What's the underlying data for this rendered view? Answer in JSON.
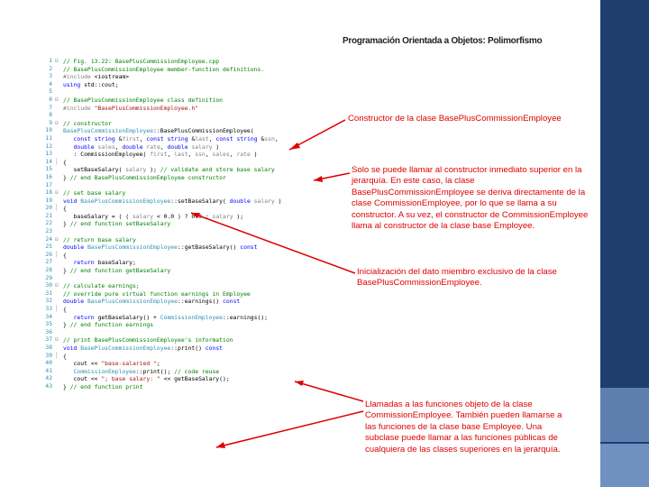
{
  "slide_title": "Programación Orientada a Objetos: Polimorfismo",
  "colors": {
    "annotation": "#e00000",
    "sidebar": "#1f3d6e",
    "comment": "#008000",
    "keyword": "#0000ff"
  },
  "editor": {
    "line_numbers": [
      "1",
      "2",
      "3",
      "4",
      "5",
      "6",
      "7",
      "8",
      "9",
      "10",
      "11",
      "12",
      "13",
      "14",
      "15",
      "16",
      "17",
      "18",
      "19",
      "20",
      "21",
      "22",
      "23",
      "24",
      "25",
      "26",
      "27",
      "28",
      "29",
      "30",
      "31",
      "32",
      "33",
      "34",
      "35",
      "36",
      "37",
      "38",
      "39",
      "40",
      "41",
      "42",
      "43"
    ],
    "lines": [
      "// Fig. 13.22: BasePlusCommissionEmployee.cpp",
      "// BasePlusCommissionEmployee member-function definitions.",
      "#include <iostream>",
      "using std::cout;",
      "",
      "// BasePlusCommissionEmployee class definition",
      "#include \"BasePlusCommissionEmployee.h\"",
      "",
      "// constructor",
      "BasePlusCommissionEmployee::BasePlusCommissionEmployee(",
      "   const string &first, const string &last, const string &ssn,",
      "   double sales, double rate, double salary )",
      "   : CommissionEmployee( first, last, ssn, sales, rate )",
      "{",
      "   setBaseSalary( salary ); // validate and store base salary",
      "} // end BasePlusCommissionEmployee constructor",
      "",
      "// set base salary",
      "void BasePlusCommissionEmployee::setBaseSalary( double salary )",
      "{",
      "   baseSalary = ( ( salary < 0.0 ) ? 0.0 : salary );",
      "} // end function setBaseSalary",
      "",
      "// return base salary",
      "double BasePlusCommissionEmployee::getBaseSalary() const",
      "{",
      "   return baseSalary;",
      "} // end function getBaseSalary",
      "",
      "// calculate earnings;",
      "// override pure virtual function earnings in Employee",
      "double BasePlusCommissionEmployee::earnings() const",
      "{",
      "   return getBaseSalary() + CommissionEmployee::earnings();",
      "} // end function earnings",
      "",
      "// print BasePlusCommissionEmployee's information",
      "void BasePlusCommissionEmployee::print() const",
      "{",
      "   cout << \"base-salaried \";",
      "   CommissionEmployee::print(); // code reuse",
      "   cout << \"; base salary: \" << getBaseSalary();",
      "} // end function print"
    ]
  },
  "annotations": {
    "constructor": "Constructor de la clase BasePlusCommissionEmployee",
    "base_call": "Solo se puede llamar al constructor inmediato superior en la jerarquía. En este caso, la clase BasePlusCommissionEmployee se deriva directamente de la clase CommissionEmployee, por lo que se llama a su constructor. A su vez, el constructor de CommissionEmployee llama al constructor de la clase base Employee.",
    "init": "Inicialización del dato miembro exclusivo de la clase BasePlusCommissionEmployee.",
    "calls": "Llamadas a las funciones objeto de la clase CommissionEmployee. También pueden llamarse a las funciones de la clase base Employee. Una subclase puede llamar a las funciones públicas de cualquiera de las clases superiores en la jerarquía."
  }
}
